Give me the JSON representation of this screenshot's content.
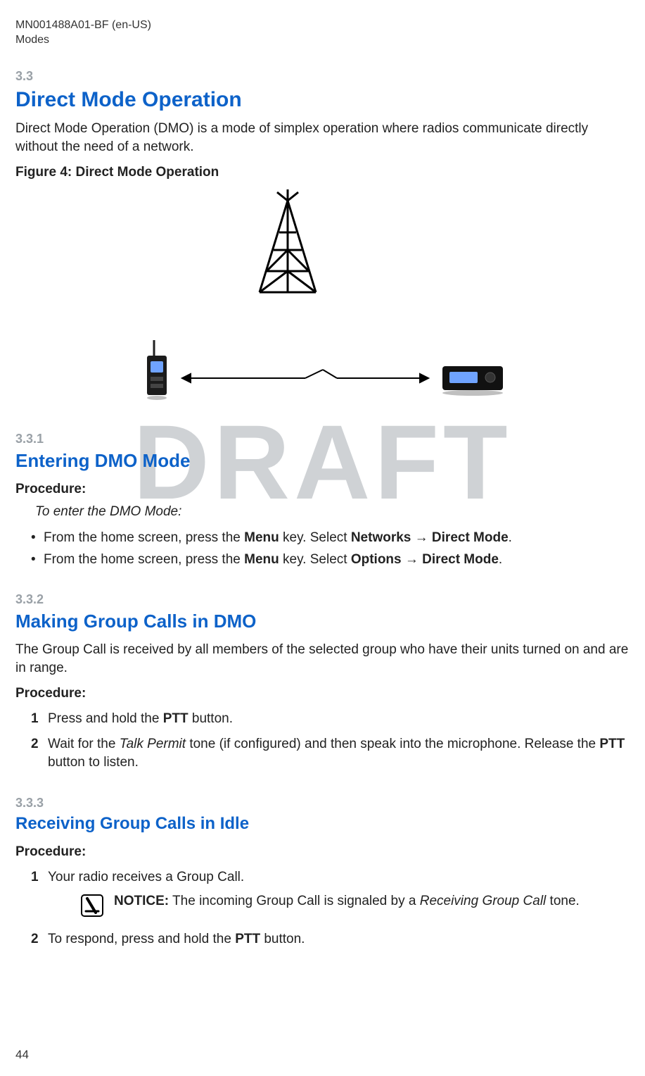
{
  "header": {
    "doc_id": "MN001488A01-BF (en-US)",
    "chapter": "Modes"
  },
  "watermark": "DRAFT",
  "sec33": {
    "num": "3.3",
    "title": "Direct Mode Operation",
    "body": "Direct Mode Operation (DMO) is a mode of simplex operation where radios communicate directly without the need of a network.",
    "fig_title": "Figure 4: Direct Mode Operation"
  },
  "sec331": {
    "num": "3.3.1",
    "title": "Entering DMO Mode",
    "procedure_label": "Procedure:",
    "intro": "To enter the DMO Mode:",
    "bullets": [
      {
        "pre": "From the home screen, press the ",
        "k1": "Menu",
        "mid": " key. Select ",
        "k2": "Networks",
        "arrow": " → ",
        "k3": "Direct Mode",
        "post": "."
      },
      {
        "pre": "From the home screen, press the ",
        "k1": "Menu",
        "mid": " key. Select ",
        "k2": "Options",
        "arrow": " → ",
        "k3": "Direct Mode",
        "post": "."
      }
    ]
  },
  "sec332": {
    "num": "3.3.2",
    "title": "Making Group Calls in DMO",
    "body": "The Group Call is received by all members of the selected group who have their units turned on and are in range.",
    "procedure_label": "Procedure:",
    "steps": [
      {
        "pre": "Press and hold the ",
        "k1": "PTT",
        "post": " button."
      },
      {
        "pre": "Wait for the ",
        "i1": "Talk Permit",
        "mid": " tone (if configured) and then speak into the microphone. Release the ",
        "k1": "PTT",
        "post": " button to listen."
      }
    ]
  },
  "sec333": {
    "num": "3.3.3",
    "title": "Receiving Group Calls in Idle",
    "procedure_label": "Procedure:",
    "step1": "Your radio receives a Group Call.",
    "notice": {
      "label": "NOTICE:",
      "pre": " The incoming Group Call is signaled by a ",
      "i1": "Receiving Group Call",
      "post": " tone."
    },
    "step2": {
      "pre": "To respond, press and hold the ",
      "k1": "PTT",
      "post": " button."
    }
  },
  "page_number": "44"
}
